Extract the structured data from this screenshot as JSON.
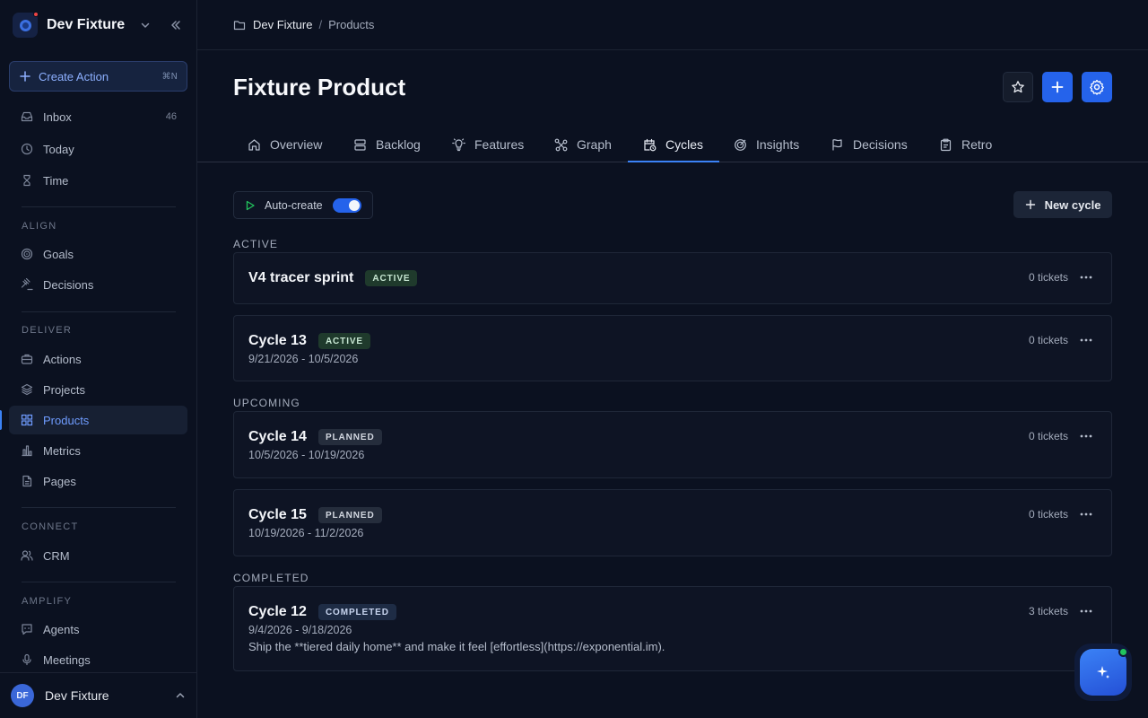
{
  "workspace": {
    "name": "Dev Fixture"
  },
  "sidebar": {
    "create_action": {
      "label": "Create Action",
      "shortcut": "⌘N"
    },
    "top_items": [
      {
        "label": "Inbox",
        "count": "46"
      },
      {
        "label": "Today"
      },
      {
        "label": "Time"
      }
    ],
    "sections": {
      "align": "ALIGN",
      "deliver": "DELIVER",
      "connect": "CONNECT",
      "amplify": "AMPLIFY"
    },
    "align_items": [
      {
        "label": "Goals"
      },
      {
        "label": "Decisions"
      }
    ],
    "deliver_items": [
      {
        "label": "Actions"
      },
      {
        "label": "Projects"
      },
      {
        "label": "Products"
      },
      {
        "label": "Metrics"
      },
      {
        "label": "Pages"
      }
    ],
    "connect_items": [
      {
        "label": "CRM"
      }
    ],
    "amplify_items": [
      {
        "label": "Agents"
      },
      {
        "label": "Meetings"
      }
    ],
    "active_item": "Products"
  },
  "user": {
    "initials": "DF",
    "name": "Dev Fixture"
  },
  "breadcrumb": {
    "root": "Dev Fixture",
    "separator": "/",
    "current": "Products"
  },
  "page": {
    "title": "Fixture Product"
  },
  "tabs": [
    {
      "label": "Overview"
    },
    {
      "label": "Backlog"
    },
    {
      "label": "Features"
    },
    {
      "label": "Graph"
    },
    {
      "label": "Cycles"
    },
    {
      "label": "Insights"
    },
    {
      "label": "Decisions"
    },
    {
      "label": "Retro"
    }
  ],
  "active_tab": "Cycles",
  "toolbar": {
    "auto_create_label": "Auto-create",
    "auto_create_on": true,
    "new_cycle_label": "New cycle"
  },
  "groups": {
    "active": "ACTIVE",
    "upcoming": "UPCOMING",
    "completed": "COMPLETED"
  },
  "cycles": [
    {
      "name": "V4 tracer sprint",
      "status": "ACTIVE",
      "dates": "",
      "tickets": "0 tickets"
    },
    {
      "name": "Cycle 13",
      "status": "ACTIVE",
      "dates": "9/21/2026 - 10/5/2026",
      "tickets": "0 tickets"
    },
    {
      "name": "Cycle 14",
      "status": "PLANNED",
      "dates": "10/5/2026 - 10/19/2026",
      "tickets": "0 tickets"
    },
    {
      "name": "Cycle 15",
      "status": "PLANNED",
      "dates": "10/19/2026 - 11/2/2026",
      "tickets": "0 tickets"
    },
    {
      "name": "Cycle 12",
      "status": "COMPLETED",
      "dates": "9/4/2026 - 9/18/2026",
      "tickets": "3 tickets",
      "description": "Ship the **tiered daily home** and make it feel [effortless](https://exponential.im)."
    }
  ],
  "colors": {
    "accent": "#2563eb",
    "background": "#0b1120",
    "card": "#0e1424",
    "active_badge": "#1f3a2c",
    "success_dot": "#22c55e"
  },
  "icons": {
    "workspace_logo": "workspace-logo-icon",
    "fab": "sparkle-icon"
  }
}
